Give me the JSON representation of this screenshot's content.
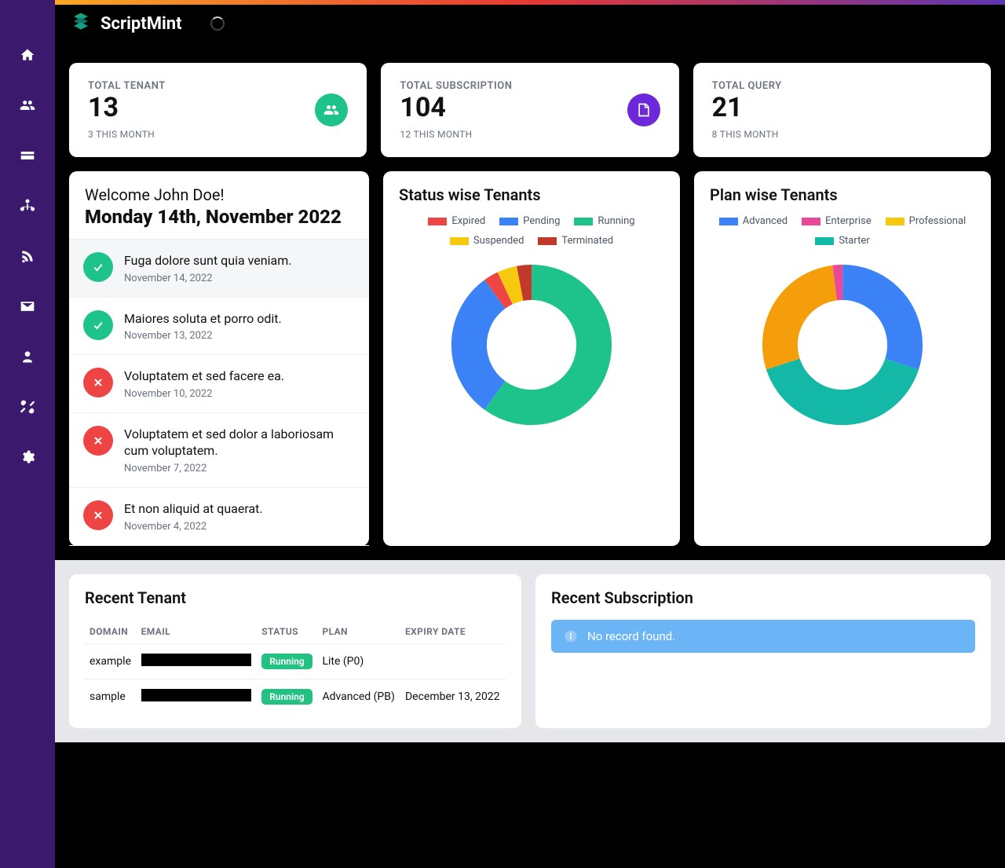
{
  "brand": {
    "name": "ScriptMint"
  },
  "sidebar": {
    "items": [
      {
        "name": "home"
      },
      {
        "name": "users"
      },
      {
        "name": "billing"
      },
      {
        "name": "org"
      },
      {
        "name": "rss"
      },
      {
        "name": "mail"
      },
      {
        "name": "team"
      },
      {
        "name": "tools"
      },
      {
        "name": "settings"
      }
    ]
  },
  "stats": [
    {
      "label": "TOTAL TENANT",
      "value": "13",
      "sub": "3 THIS MONTH",
      "icon": "team",
      "iconBg": "#1ec28b"
    },
    {
      "label": "TOTAL SUBSCRIPTION",
      "value": "104",
      "sub": "12 THIS MONTH",
      "icon": "note",
      "iconBg": "#6d28d9"
    },
    {
      "label": "TOTAL QUERY",
      "value": "21",
      "sub": "8 THIS MONTH",
      "icon": "",
      "iconBg": ""
    }
  ],
  "welcome": {
    "greeting": "Welcome John Doe!",
    "date": "Monday 14th, November 2022",
    "feed": [
      {
        "status": "ok",
        "title": "Fuga dolore sunt quia veniam.",
        "date": "November 14, 2022"
      },
      {
        "status": "ok",
        "title": "Maiores soluta et porro odit.",
        "date": "November 13, 2022"
      },
      {
        "status": "err",
        "title": "Voluptatem et sed facere ea.",
        "date": "November 10, 2022"
      },
      {
        "status": "err",
        "title": "Voluptatem et sed dolor a laboriosam cum voluptatem.",
        "date": "November 7, 2022"
      },
      {
        "status": "err",
        "title": "Et non aliquid at quaerat.",
        "date": "November 4, 2022"
      }
    ]
  },
  "chart1": {
    "title": "Status wise Tenants",
    "legend": [
      {
        "label": "Expired",
        "color": "#ef4444"
      },
      {
        "label": "Pending",
        "color": "#3b82f6"
      },
      {
        "label": "Running",
        "color": "#1ec28b"
      },
      {
        "label": "Suspended",
        "color": "#f6c90e"
      },
      {
        "label": "Terminated",
        "color": "#c0392b"
      }
    ]
  },
  "chart2": {
    "title": "Plan wise Tenants",
    "legend": [
      {
        "label": "Advanced",
        "color": "#3b82f6"
      },
      {
        "label": "Enterprise",
        "color": "#ec4899"
      },
      {
        "label": "Professional",
        "color": "#f6c90e"
      },
      {
        "label": "Starter",
        "color": "#14b8a6"
      }
    ]
  },
  "recentTenant": {
    "title": "Recent Tenant",
    "cols": [
      "DOMAIN",
      "EMAIL",
      "STATUS",
      "PLAN",
      "EXPIRY DATE"
    ],
    "rows": [
      {
        "domain": "example",
        "status": "Running",
        "plan": "Lite (P0)",
        "expiry": ""
      },
      {
        "domain": "sample",
        "status": "Running",
        "plan": "Advanced (PB)",
        "expiry": "December 13, 2022"
      }
    ]
  },
  "recentSub": {
    "title": "Recent Subscription",
    "empty": "No record found."
  },
  "chart_data": [
    {
      "type": "pie",
      "title": "Status wise Tenants",
      "series": [
        {
          "name": "Running",
          "value": 60,
          "color": "#1ec28b"
        },
        {
          "name": "Pending",
          "value": 30,
          "color": "#3b82f6"
        },
        {
          "name": "Expired",
          "value": 3,
          "color": "#ef4444"
        },
        {
          "name": "Suspended",
          "value": 4,
          "color": "#f6c90e"
        },
        {
          "name": "Terminated",
          "value": 3,
          "color": "#c0392b"
        }
      ]
    },
    {
      "type": "pie",
      "title": "Plan wise Tenants",
      "series": [
        {
          "name": "Advanced",
          "value": 30,
          "color": "#3b82f6"
        },
        {
          "name": "Starter",
          "value": 40,
          "color": "#14b8a6"
        },
        {
          "name": "Professional",
          "value": 28,
          "color": "#f59e0b"
        },
        {
          "name": "Enterprise",
          "value": 2,
          "color": "#ec4899"
        }
      ]
    }
  ]
}
